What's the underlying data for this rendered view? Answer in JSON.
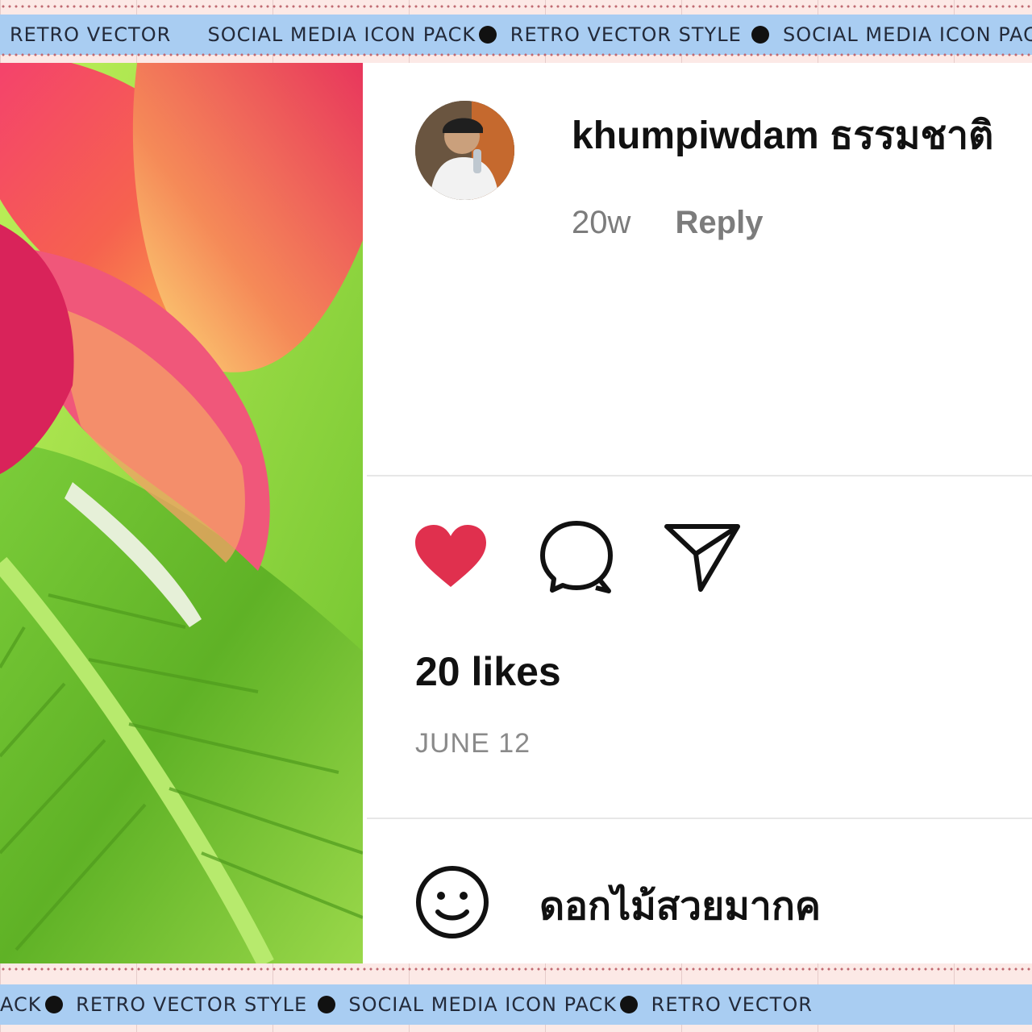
{
  "banner_top": {
    "segments": [
      "RETRO VECTOR",
      "SOCIAL MEDIA ICON PACK",
      "RETRO VECTOR STYLE",
      "SOCIAL MEDIA ICON PACK"
    ]
  },
  "banner_bottom": {
    "segments": [
      "ACK",
      "RETRO VECTOR STYLE",
      "SOCIAL MEDIA ICON PACK",
      "RETRO VECTOR"
    ]
  },
  "post": {
    "username": "khumpiwdam ธรรมชาติ",
    "time_ago": "20w",
    "reply_label": "Reply",
    "likes": "20 likes",
    "date": "JUNE 12",
    "liked": true
  },
  "icons": {
    "like": "heart-icon",
    "comment": "comment-bubble-icon",
    "share": "send-paper-plane-icon",
    "emoji": "smiley-face-icon"
  },
  "comment_box": {
    "value": "ดอกไม้สวยมากค"
  },
  "colors": {
    "heart": "#e0304e",
    "banner": "#a9cdf2",
    "background": "#fce9e6"
  }
}
